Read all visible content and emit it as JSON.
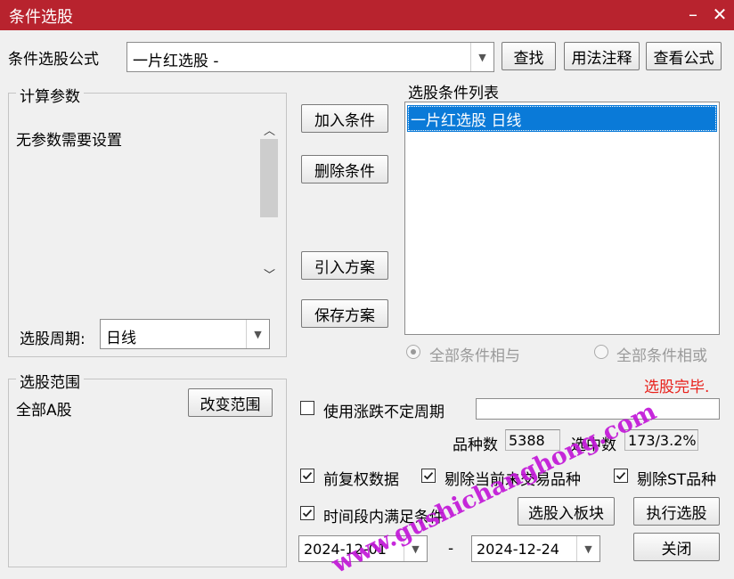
{
  "window": {
    "title": "条件选股",
    "minimize_icon": "minimize-icon",
    "close_icon": "close-icon"
  },
  "formula": {
    "label": "条件选股公式",
    "value": "一片红选股  -",
    "find_label": "查找",
    "usage_label": "用法注释",
    "view_label": "查看公式"
  },
  "params": {
    "group_title": "计算参数",
    "none_text": "无参数需要设置",
    "period_label": "选股周期:",
    "period_value": "日线"
  },
  "actions": {
    "add": "加入条件",
    "delete": "删除条件",
    "import": "引入方案",
    "save": "保存方案"
  },
  "condition_list": {
    "title": "选股条件列表",
    "items": [
      "一片红选股  日线"
    ]
  },
  "logic": {
    "and_label": "全部条件相与",
    "or_label": "全部条件相或",
    "selected": "and"
  },
  "range": {
    "group_title": "选股范围",
    "value": "全部A股",
    "change_label": "改变范围"
  },
  "status": {
    "text": "选股完毕.",
    "color": "#e8201a"
  },
  "volatile": {
    "label": "使用涨跌不定周期",
    "checked": false,
    "value": ""
  },
  "stats": {
    "count_label": "品种数",
    "count_value": "5388",
    "selected_label": "选中数",
    "selected_value": "173/3.2%"
  },
  "options": {
    "adjusted": {
      "label": "前复权数据",
      "checked": true
    },
    "exclude_untraded": {
      "label": "剔除当前未交易品种",
      "checked": true
    },
    "exclude_st": {
      "label": "剔除ST品种",
      "checked": true
    },
    "time_range": {
      "label": "时间段内满足条件",
      "checked": true
    }
  },
  "dates": {
    "start": "2024-12-01",
    "separator": "-",
    "end": "2024-12-24"
  },
  "buttons": {
    "to_block": "选股入板块",
    "execute": "执行选股",
    "close": "关闭"
  },
  "watermark": {
    "text": "www.gushichanghong.com",
    "color": "#c217d8"
  }
}
